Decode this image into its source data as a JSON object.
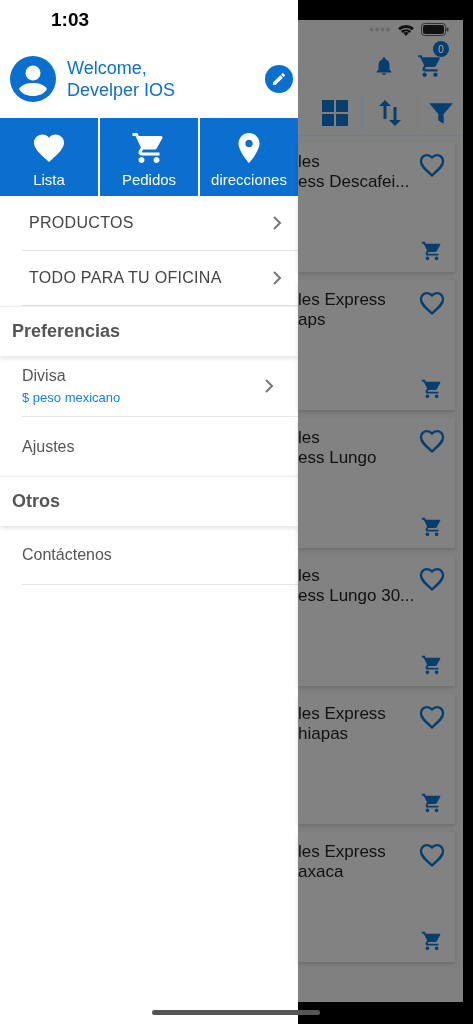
{
  "status_bar": {
    "time": "1:03"
  },
  "drawer": {
    "user": {
      "greeting": "Welcome,",
      "name": "Develper IOS"
    },
    "quick_actions": [
      {
        "kind": "heart",
        "label": "Lista"
      },
      {
        "kind": "cart",
        "label": "Pedidos"
      },
      {
        "kind": "pin",
        "label": "direcciones"
      }
    ],
    "categories": [
      {
        "label": "PRODUCTOS"
      },
      {
        "label": "TODO PARA TU OFICINA"
      }
    ],
    "sections": [
      {
        "title": "Preferencias",
        "items": [
          {
            "label": "Divisa",
            "value": "$ peso mexicano",
            "has_chevron": true
          },
          {
            "label": "Ajustes",
            "has_chevron": false
          }
        ]
      },
      {
        "title": "Otros",
        "items": [
          {
            "label": "Contáctenos",
            "has_chevron": false
          }
        ]
      }
    ]
  },
  "background_app": {
    "cart_badge": "0",
    "products": [
      {
        "line_1": "les",
        "line_2": "ess Descafei..."
      },
      {
        "line_1": "les Express",
        "line_2": "aps"
      },
      {
        "line_1": "les",
        "line_2": "ess Lungo"
      },
      {
        "line_1": "les",
        "line_2": "ess Lungo 30..."
      },
      {
        "line_1": "les Express",
        "line_2": "hiapas"
      },
      {
        "line_1": "les Express",
        "line_2": "axaca"
      }
    ]
  }
}
